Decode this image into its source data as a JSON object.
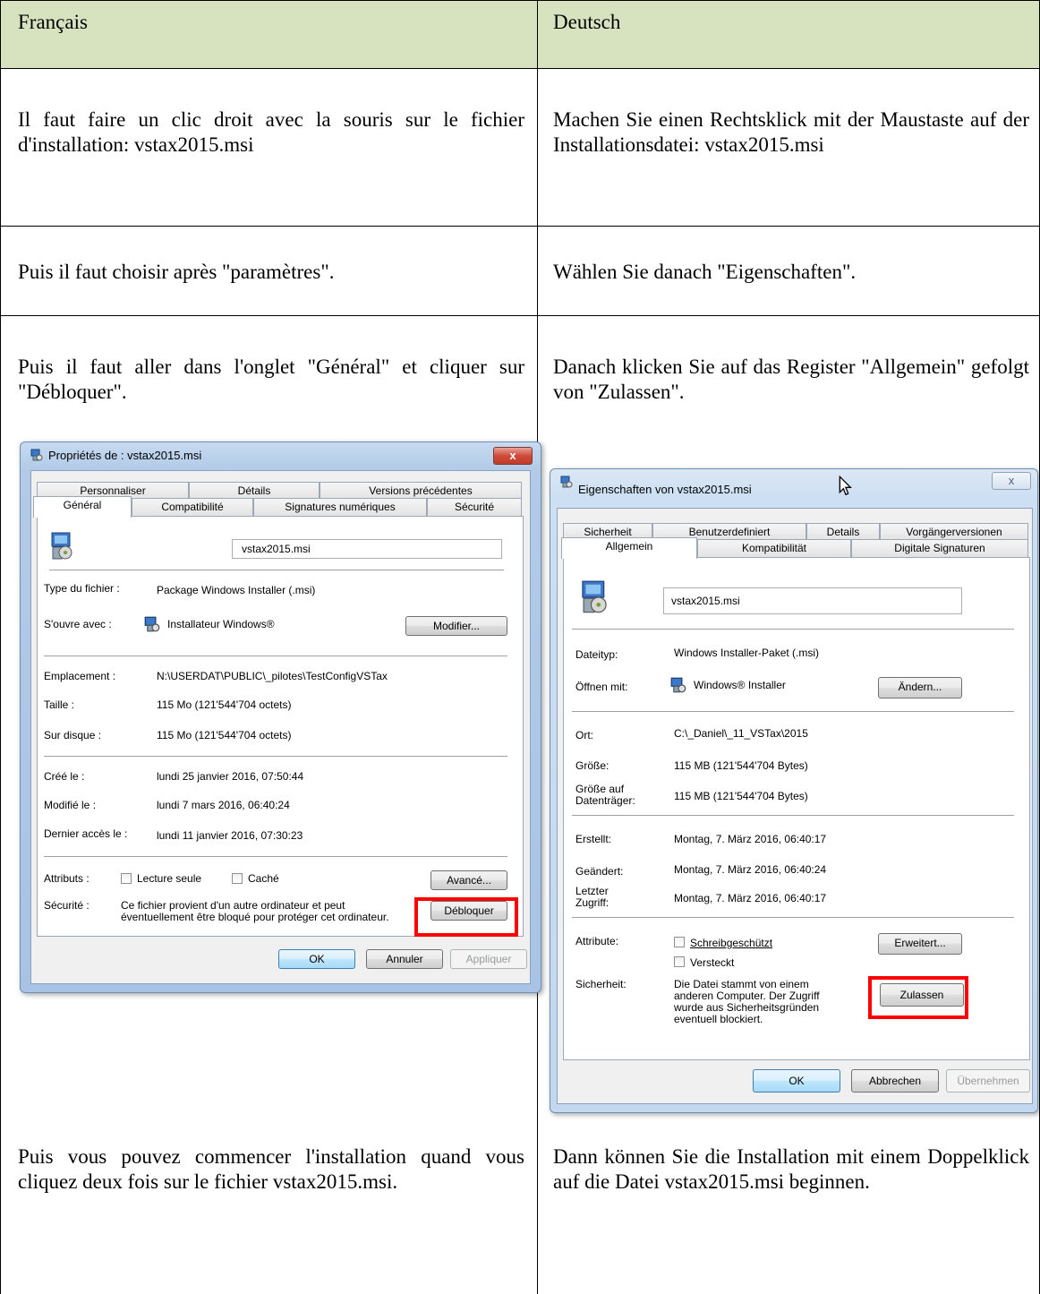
{
  "table": {
    "headers": {
      "fr": "Français",
      "de": "Deutsch"
    },
    "rows": [
      {
        "fr": "Il faut faire un clic droit avec la souris sur le fichier d'installation: vstax2015.msi",
        "de": "Machen Sie einen Rechtsklick mit der Maustaste auf der Installationsdatei: vstax2015.msi"
      },
      {
        "fr": "Puis il faut choisir après \"paramètres\".",
        "de": "Wählen Sie danach \"Eigenschaften\"."
      },
      {
        "fr": "Puis il faut aller dans l'onglet \"Général\" et cliquer sur \"Débloquer\".",
        "de": "Danach klicken Sie auf das Register \"Allgemein\" gefolgt von \"Zulassen\"."
      },
      {
        "fr": "Puis vous pouvez commencer l'installation quand vous cliquez deux fois sur le fichier vstax2015.msi.",
        "de": "Dann können Sie die Installation mit einem Doppelklick auf die Datei vstax2015.msi beginnen."
      }
    ]
  },
  "dialog_fr": {
    "title": "Propriétés de : vstax2015.msi",
    "close": "x",
    "tabs_back": [
      "Personnaliser",
      "Détails",
      "Versions précédentes"
    ],
    "tabs_front": [
      "Général",
      "Compatibilité",
      "Signatures numériques",
      "Sécurité"
    ],
    "filename": "vstax2015.msi",
    "type_label": "Type du fichier :",
    "type_value": "Package Windows Installer (.msi)",
    "opens_label": "S'ouvre avec :",
    "opens_value": "Installateur Windows®",
    "modify_button": "Modifier...",
    "location_label": "Emplacement :",
    "location_value": "N:\\USERDAT\\PUBLIC\\_pilotes\\TestConfigVSTax",
    "size_label": "Taille :",
    "size_value": "115 Mo (121'544'704 octets)",
    "disk_label": "Sur disque :",
    "disk_value": "115 Mo (121'544'704 octets)",
    "created_label": "Créé le :",
    "created_value": "lundi 25 janvier 2016, 07:50:44",
    "modified_label": "Modifié le :",
    "modified_value": "lundi 7 mars 2016, 06:40:24",
    "accessed_label": "Dernier accès le :",
    "accessed_value": "lundi 11 janvier 2016, 07:30:23",
    "attributes_label": "Attributs :",
    "readonly_label": "Lecture seule",
    "hidden_label": "Caché",
    "advanced_button": "Avancé...",
    "security_label": "Sécurité :",
    "security_text_1": "Ce fichier provient d'un autre ordinateur et peut",
    "security_text_2": "éventuellement être bloqué pour protéger cet ordinateur.",
    "unblock_button": "Débloquer",
    "ok_button": "OK",
    "cancel_button": "Annuler",
    "apply_button": "Appliquer"
  },
  "dialog_de": {
    "title": "Eigenschaften von vstax2015.msi",
    "close": "x",
    "tabs_back": [
      "Sicherheit",
      "Benutzerdefiniert",
      "Details",
      "Vorgängerversionen"
    ],
    "tabs_front": [
      "Allgemein",
      "Kompatibilität",
      "Digitale Signaturen"
    ],
    "filename": "vstax2015.msi",
    "type_label": "Dateityp:",
    "type_value": "Windows Installer-Paket (.msi)",
    "opens_label": "Öffnen mit:",
    "opens_value": "Windows® Installer",
    "change_button": "Ändern...",
    "location_label": "Ort:",
    "location_value": "C:\\_Daniel\\_11_VSTax\\2015",
    "size_label": "Größe:",
    "size_value": "115 MB (121'544'704 Bytes)",
    "disk_label_1": "Größe auf",
    "disk_label_2": "Datenträger:",
    "disk_value": "115 MB (121'544'704 Bytes)",
    "created_label": "Erstellt:",
    "created_value": "Montag, 7. März 2016, 06:40:17",
    "modified_label": "Geändert:",
    "modified_value": "Montag, 7. März 2016, 06:40:24",
    "accessed_label_1": "Letzter",
    "accessed_label_2": "Zugriff:",
    "accessed_value": "Montag, 7. März 2016, 06:40:17",
    "attributes_label": "Attribute:",
    "readonly_label": "Schreibgeschützt",
    "hidden_label": "Versteckt",
    "advanced_button": "Erweitert...",
    "security_label": "Sicherheit:",
    "security_text_1": "Die Datei stammt von einem",
    "security_text_2": "anderen Computer. Der Zugriff",
    "security_text_3": "wurde aus Sicherheitsgründen",
    "security_text_4": "eventuell blockiert.",
    "allow_button": "Zulassen",
    "ok_button": "OK",
    "cancel_button": "Abbrechen",
    "apply_button": "Übernehmen"
  }
}
